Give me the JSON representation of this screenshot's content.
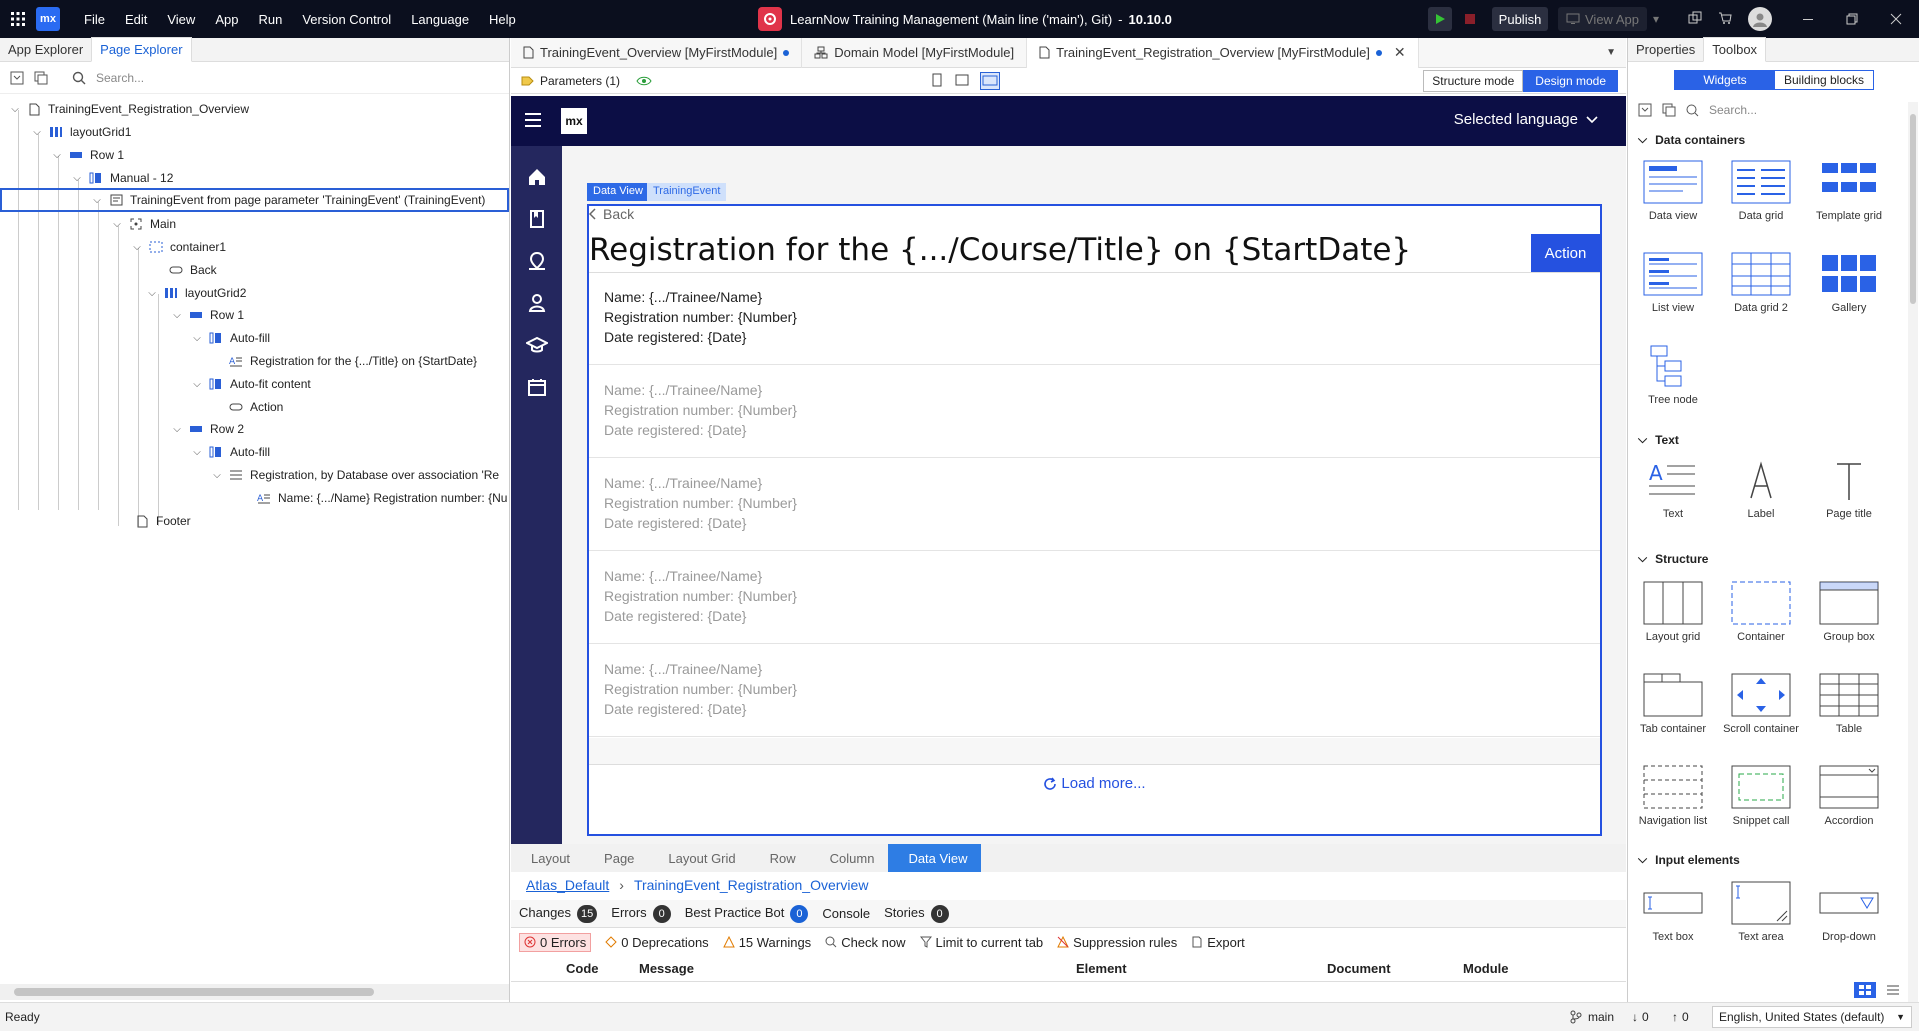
{
  "titlebar": {
    "menu": [
      "File",
      "Edit",
      "View",
      "App",
      "Run",
      "Version Control",
      "Language",
      "Help"
    ],
    "title": "LearnNow Training Management (Main line ('main'), Git)",
    "version": "10.10.0",
    "publish": "Publish",
    "view_app": "View App",
    "logo": "mx"
  },
  "left": {
    "tabs": [
      "App Explorer",
      "Page Explorer"
    ],
    "search_placeholder": "Search...",
    "tree": [
      "TrainingEvent_Registration_Overview",
      "layoutGrid1",
      "Row 1",
      "Manual - 12",
      "TrainingEvent from page parameter 'TrainingEvent' (TrainingEvent)",
      "Main",
      "container1",
      "Back",
      "layoutGrid2",
      "Row 1",
      "Auto-fill",
      "Registration for the {.../Title} on {StartDate}",
      "Auto-fit content",
      "Action",
      "Row 2",
      "Auto-fill",
      "Registration, by Database over association 'Re",
      "Name: {.../Name} Registration number: {Nu",
      "Footer"
    ]
  },
  "center": {
    "tabs": [
      "TrainingEvent_Overview [MyFirstModule]",
      "Domain Model [MyFirstModule]",
      "TrainingEvent_Registration_Overview [MyFirstModule]"
    ],
    "parameters": "Parameters (1)",
    "structure_mode": "Structure mode",
    "design_mode": "Design mode",
    "app": {
      "logo": "mx",
      "language": "Selected language",
      "dv_label": "Data View",
      "entity_label": "TrainingEvent",
      "back": "Back",
      "title": "Registration for the {.../Course/Title} on {StartDate}",
      "action": "Action",
      "load_more": "Load more...",
      "item": {
        "name": "Name: {.../Trainee/Name}",
        "number": "Registration number: {Number}",
        "date": "Date registered: {Date}"
      }
    },
    "crumbs": [
      "Layout",
      "Page",
      "Layout Grid",
      "Row",
      "Column",
      "Data View"
    ],
    "path": {
      "layout": "Atlas_Default",
      "page": "TrainingEvent_Registration_Overview"
    },
    "bottom_tabs": [
      {
        "label": "Changes",
        "count": "15"
      },
      {
        "label": "Errors",
        "count": "0"
      },
      {
        "label": "Best Practice Bot",
        "count": "0"
      },
      {
        "label": "Console"
      },
      {
        "label": "Stories",
        "count": "0"
      }
    ],
    "errbar": {
      "errors": "0 Errors",
      "deprecations": "0 Deprecations",
      "warnings": "15 Warnings",
      "check": "Check now",
      "limit": "Limit to current tab",
      "suppression": "Suppression rules",
      "export": "Export"
    },
    "columns": [
      "Code",
      "Message",
      "Element",
      "Document",
      "Module"
    ]
  },
  "right": {
    "tabs": [
      "Properties",
      "Toolbox"
    ],
    "widgets": "Widgets",
    "blocks": "Building blocks",
    "search_placeholder": "Search...",
    "sections": {
      "data": "Data containers",
      "text": "Text",
      "structure": "Structure",
      "input": "Input elements"
    },
    "tools": {
      "dataview": "Data view",
      "datagrid": "Data grid",
      "templategrid": "Template grid",
      "listview": "List view",
      "datagrid2": "Data grid 2",
      "gallery": "Gallery",
      "treenode": "Tree node",
      "text": "Text",
      "label": "Label",
      "pagetitle": "Page title",
      "layoutgrid": "Layout grid",
      "container": "Container",
      "groupbox": "Group box",
      "tabcontainer": "Tab container",
      "scrollcontainer": "Scroll container",
      "table": "Table",
      "navlist": "Navigation list",
      "snippetcall": "Snippet call",
      "accordion": "Accordion",
      "textbox": "Text box",
      "textarea": "Text area",
      "dropdown": "Drop-down"
    }
  },
  "status": {
    "ready": "Ready",
    "branch": "main",
    "down": "0",
    "up": "0",
    "locale": "English, United States (default)"
  }
}
